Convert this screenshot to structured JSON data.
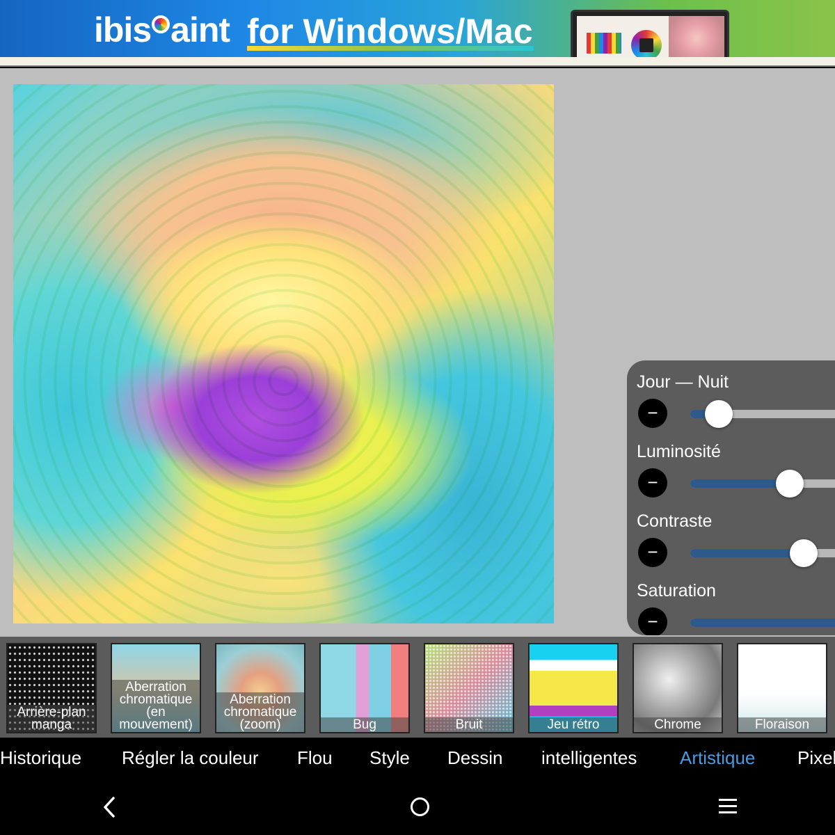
{
  "ad": {
    "brand_pre": "ibis",
    "brand_post": "aint",
    "slogan": "for Windows/Mac"
  },
  "adjustments": [
    {
      "label": "Jour — Nuit",
      "value": 0.18
    },
    {
      "label": "Luminosité",
      "value": 0.62
    },
    {
      "label": "Contraste",
      "value": 0.71
    },
    {
      "label": "Saturation",
      "value": null
    }
  ],
  "filters": [
    {
      "label": "Arrière-plan manga",
      "thumb": "manga"
    },
    {
      "label": "Aberration chromatique (en mouvement)",
      "thumb": "aber1"
    },
    {
      "label": "Aberration chromatique (zoom)",
      "thumb": "aber2"
    },
    {
      "label": "Bug",
      "thumb": "bug"
    },
    {
      "label": "Bruit",
      "thumb": "noise"
    },
    {
      "label": "Jeu rétro",
      "thumb": "retro"
    },
    {
      "label": "Chrome",
      "thumb": "chrome"
    },
    {
      "label": "Floraison",
      "thumb": "flor"
    }
  ],
  "tabs": [
    {
      "label": "Historique",
      "active": false
    },
    {
      "label": "Régler la couleur",
      "active": false
    },
    {
      "label": "Flou",
      "active": false
    },
    {
      "label": "Style",
      "active": false
    },
    {
      "label": "Dessin",
      "active": false
    },
    {
      "label": "intelligentes",
      "active": false
    },
    {
      "label": "Artistique",
      "active": true
    },
    {
      "label": "Pixel",
      "active": false
    }
  ],
  "colors": {
    "accent_tab": "#4a9be0",
    "slider_fill": "#2d5a8a",
    "panel_bg": "#5c5c5c"
  },
  "icons": {
    "back": "chevron-left-icon",
    "home": "circle-home-icon",
    "menu": "hamburger-menu-icon",
    "minus": "minus-icon"
  }
}
